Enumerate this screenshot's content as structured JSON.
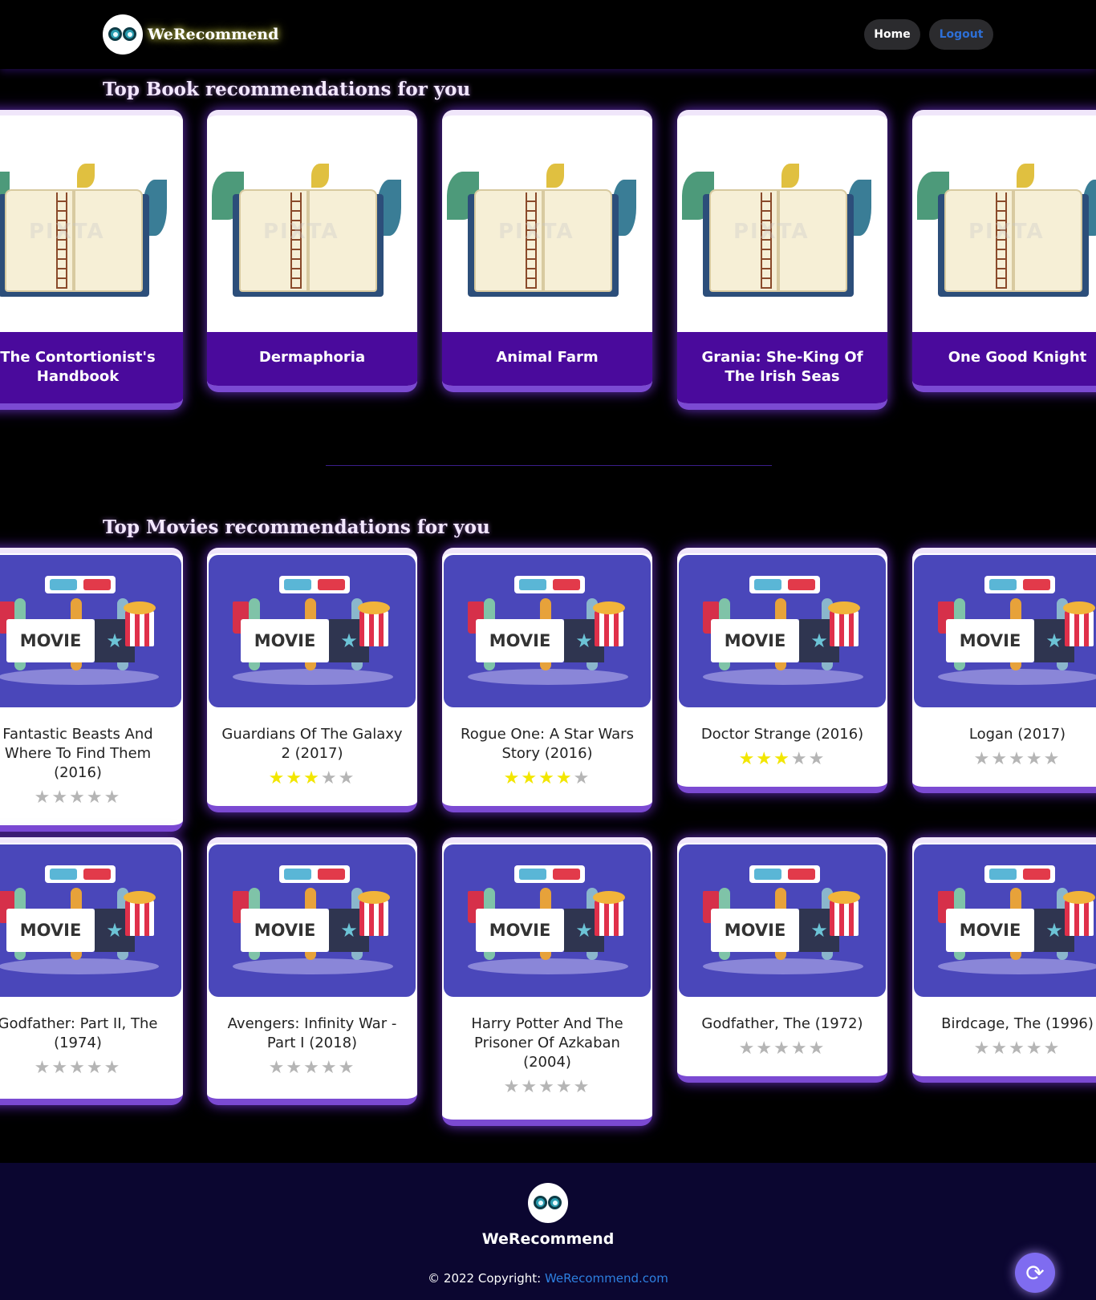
{
  "header": {
    "brand": "WeRecommend",
    "nav": {
      "home": "Home",
      "logout": "Logout"
    }
  },
  "books": {
    "title": "Top Book recommendations for you",
    "watermark": "PIXTA",
    "items": [
      {
        "title": "The Contortionist's Handbook"
      },
      {
        "title": "Dermaphoria"
      },
      {
        "title": "Animal Farm"
      },
      {
        "title": "Grania: She-King Of The Irish Seas"
      },
      {
        "title": "One Good Knight"
      }
    ]
  },
  "movies": {
    "title": "Top Movies recommendations for you",
    "poster_label": "MOVIE",
    "star_icon": "★",
    "items": [
      {
        "title": "Fantastic Beasts And Where To Find Them (2016)",
        "rating": 0
      },
      {
        "title": "Guardians Of The Galaxy 2 (2017)",
        "rating": 3
      },
      {
        "title": "Rogue One: A Star Wars Story (2016)",
        "rating": 4
      },
      {
        "title": "Doctor Strange (2016)",
        "rating": 3
      },
      {
        "title": "Logan (2017)",
        "rating": 0
      },
      {
        "title": "Godfather: Part II, The (1974)",
        "rating": 0
      },
      {
        "title": "Avengers: Infinity War - Part I (2018)",
        "rating": 0
      },
      {
        "title": "Harry Potter And The Prisoner Of Azkaban (2004)",
        "rating": 0
      },
      {
        "title": "Godfather, The (1972)",
        "rating": 0
      },
      {
        "title": "Birdcage, The (1996)",
        "rating": 0
      }
    ]
  },
  "footer": {
    "brand": "WeRecommend",
    "copyright": "© 2022 Copyright: ",
    "link": "WeRecommend.com"
  },
  "colors": {
    "accent": "#4a0a9c",
    "star_on": "#f2e600",
    "star_off": "#b5b5b5",
    "link": "#2d7fe0"
  }
}
